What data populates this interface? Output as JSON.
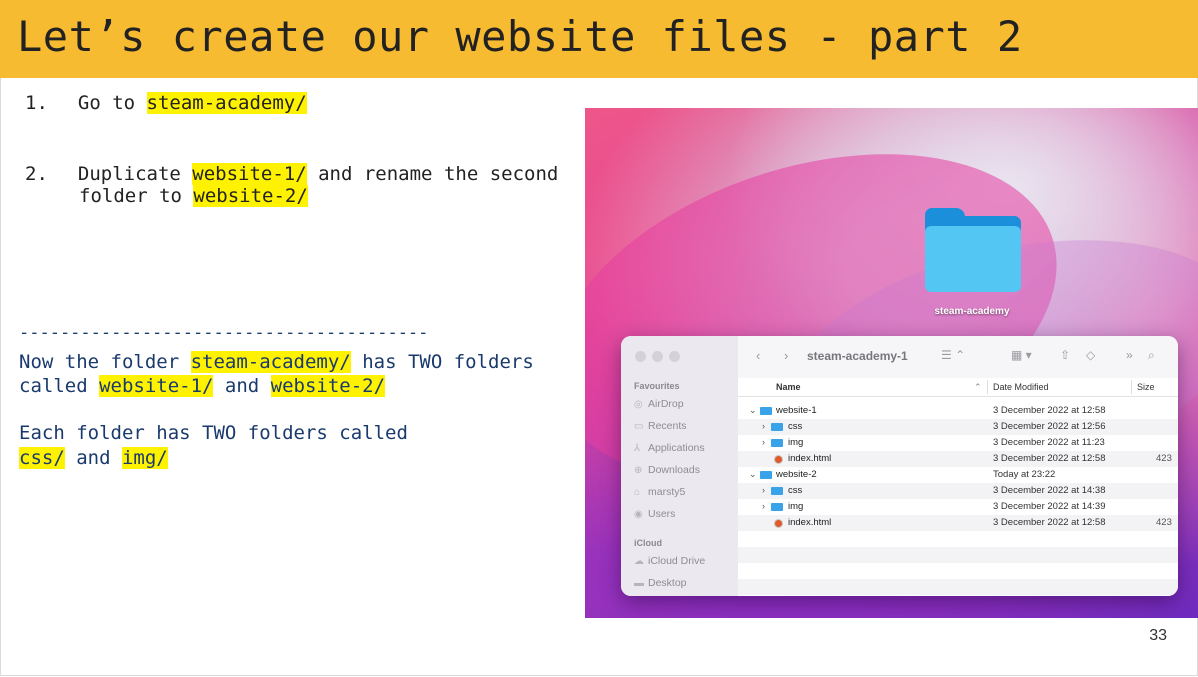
{
  "slide": {
    "title": "Let’s create our website files - part 2",
    "page_number": "33"
  },
  "steps": {
    "step1": {
      "num": "1.",
      "text": "Go to ",
      "highlight": "steam-academy/"
    },
    "step2": {
      "num": "2.",
      "line1_text": "Duplicate ",
      "line1_highlight": "website-1/",
      "line1_rest": " and rename the second",
      "line2_text": "folder to ",
      "line2_highlight": "website-2/"
    }
  },
  "note": {
    "divider": "----------------------------------------",
    "p1_l1_a": "Now the folder ",
    "p1_l1_hl": "steam-academy/",
    "p1_l1_b": " has TWO folders",
    "p1_l2_a": "called ",
    "p1_l2_hl1": "website-1/",
    "p1_l2_b": " and ",
    "p1_l2_hl2": "website-2/",
    "p2_l1": "Each folder has TWO folders called",
    "p2_l2_hl1": "css/",
    "p2_l2_b": " and ",
    "p2_l2_hl2": "img/"
  },
  "desktop": {
    "folder_label": "steam-academy",
    "folder_icon": "folder-icon"
  },
  "finder": {
    "title": "steam-academy-1",
    "sidebar": {
      "favourites_header": "Favourites",
      "favourites": [
        {
          "label": "AirDrop",
          "icon": "airdrop-icon"
        },
        {
          "label": "Recents",
          "icon": "recents-icon"
        },
        {
          "label": "Applications",
          "icon": "applications-icon"
        },
        {
          "label": "Downloads",
          "icon": "downloads-icon"
        },
        {
          "label": "marsty5",
          "icon": "home-icon"
        },
        {
          "label": "Users",
          "icon": "users-icon"
        }
      ],
      "icloud_header": "iCloud",
      "icloud": [
        {
          "label": "iCloud Drive",
          "icon": "icloud-icon"
        },
        {
          "label": "Desktop",
          "icon": "desktop-icon"
        }
      ]
    },
    "columns": {
      "name": "Name",
      "date": "Date Modified",
      "size": "Size"
    },
    "rows": [
      {
        "name": "website-1",
        "date": "3 December 2022 at 12:58",
        "size": ""
      },
      {
        "name": "css",
        "date": "3 December 2022 at 12:56",
        "size": ""
      },
      {
        "name": "img",
        "date": "3 December 2022 at 11:23",
        "size": ""
      },
      {
        "name": "index.html",
        "date": "3 December 2022 at 12:58",
        "size": "423"
      },
      {
        "name": "website-2",
        "date": "Today at 23:22",
        "size": ""
      },
      {
        "name": "css",
        "date": "3 December 2022 at 14:38",
        "size": ""
      },
      {
        "name": "img",
        "date": "3 December 2022 at 14:39",
        "size": ""
      },
      {
        "name": "index.html",
        "date": "3 December 2022 at 12:58",
        "size": "423"
      }
    ]
  }
}
